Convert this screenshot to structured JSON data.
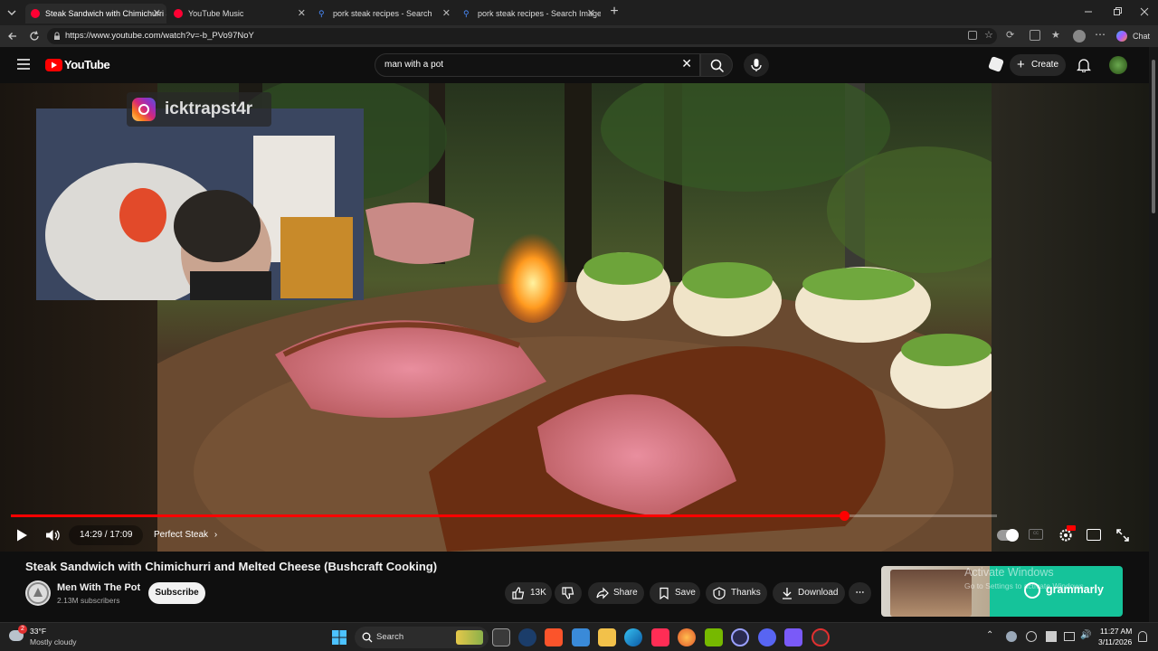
{
  "browser": {
    "tabs": [
      {
        "label": "Steak Sandwich with Chimichurri a",
        "active": true,
        "icon_color": "#ff0033"
      },
      {
        "label": "YouTube Music",
        "active": false,
        "icon_color": "#ff0033"
      },
      {
        "label": "pork steak recipes - Search",
        "active": false,
        "icon_color": "#4a8cff"
      },
      {
        "label": "pork steak recipes - Search Images",
        "active": false,
        "icon_color": "#4a8cff"
      }
    ],
    "url": "https://www.youtube.com/watch?v=-b_PVo97NoY",
    "chat_label": "Chat"
  },
  "youtube": {
    "logo_text": "YouTube",
    "search_value": "man with a pot",
    "create_label": "Create"
  },
  "player": {
    "instagram_handle": "icktrapst4r",
    "time_current": "14:29",
    "time_total": "17:09",
    "time_display": "14:29 / 17:09",
    "chapter": "Perfect Steak",
    "progress": 0.845,
    "accent": "#ff0000"
  },
  "video": {
    "title": "Steak Sandwich with Chimichurri and Melted Cheese (Bushcraft Cooking)",
    "channel": "Men With The Pot",
    "subscribers": "2.13M subscribers",
    "subscribe_label": "Subscribe",
    "likes": "13K",
    "share_label": "Share",
    "save_label": "Save",
    "thanks_label": "Thanks",
    "download_label": "Download"
  },
  "ad": {
    "brand": "grammarly",
    "overlay_title": "Activate Windows",
    "overlay_sub": "Go to Settings to activate Windows."
  },
  "taskbar": {
    "weather_temp": "33°F",
    "weather_desc": "Mostly cloudy",
    "weather_badge": "2",
    "search_label": "Search",
    "time": "11:27 AM",
    "date": "3/11/2026"
  }
}
